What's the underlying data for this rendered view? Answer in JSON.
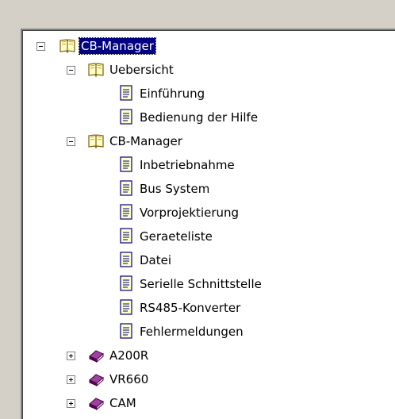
{
  "tree": {
    "root": {
      "label": "CB-Manager",
      "icon": "open-book-icon",
      "expanded": true,
      "selected": true
    },
    "uebersicht": {
      "label": "Uebersicht",
      "icon": "open-book-icon",
      "expanded": true,
      "children": [
        "Einführung",
        "Bedienung der Hilfe"
      ]
    },
    "cbmanager": {
      "label": "CB-Manager",
      "icon": "open-book-icon",
      "expanded": true,
      "children": [
        "Inbetriebnahme",
        "Bus System",
        "Vorprojektierung",
        "Geraeteliste",
        "Datei",
        "Serielle Schnittstelle",
        "RS485-Konverter",
        "Fehlermeldungen"
      ]
    },
    "collapsed": [
      {
        "label": "A200R",
        "icon": "closed-book-icon"
      },
      {
        "label": "VR660",
        "icon": "closed-book-icon"
      },
      {
        "label": "CAM",
        "icon": "closed-book-icon"
      }
    ]
  },
  "colors": {
    "page_icon_fill": "#ffffcc",
    "closed_book": "#800080",
    "selection": "#000080"
  }
}
